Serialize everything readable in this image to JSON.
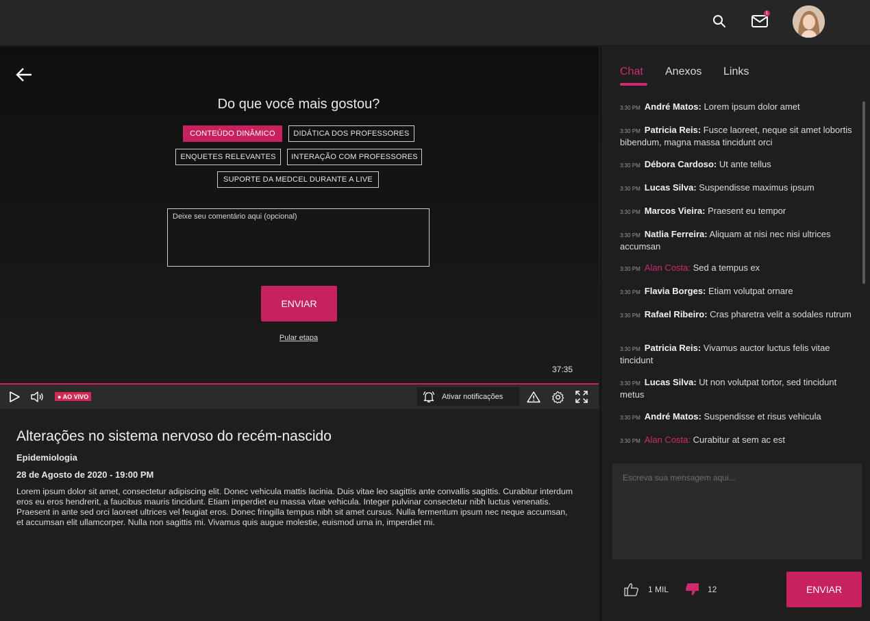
{
  "header": {
    "search_icon": "search-icon",
    "mail_icon": "mail-icon",
    "mail_badge": "1",
    "avatar": "user-avatar"
  },
  "survey": {
    "title": "Do que você mais gostou?",
    "options": [
      {
        "label": "CONTEÚDO DINÂMICO",
        "selected": true
      },
      {
        "label": "DIDÁTICA DOS PROFESSORES",
        "selected": false
      },
      {
        "label": "ENQUETES RELEVANTES",
        "selected": false
      },
      {
        "label": "INTERAÇÃO COM PROFESSORES",
        "selected": false
      },
      {
        "label": "SUPORTE DA MEDCEL DURANTE A LIVE",
        "selected": false
      }
    ],
    "comment_placeholder": "Deixe seu comentário aqui (opcional)",
    "submit_label": "ENVIAR",
    "skip_label": "Pular etapa"
  },
  "player": {
    "time": "37:35",
    "live_label": "● AO VIVO",
    "notify_label": "Ativar notificações"
  },
  "lesson": {
    "title": "Alterações no sistema nervoso do recém-nascido",
    "category": "Epidemiologia",
    "date": "28 de Agosto de 2020 - 19:00 PM",
    "description": "Lorem ipsum dolor sit amet, consectetur adipiscing elit. Donec vehicula mattis lacinia. Duis vitae leo sagittis ante convallis sagittis. Curabitur interdum eros eu eros hendrerit, a faucibus mauris tincidunt. Etiam imperdiet eu massa vitae vehicula. Integer pulvinar consectetur nibh luctus venenatis. Praesent in ante sed orci laoreet ultrices vel feugiat eros. Donec fringilla tempus nibh sit amet cursus. Nulla fermentum ipsum nec neque accumsan, et accumsan elit ullamcorper. Nulla non sagittis mi. Vivamus quis augue molestie, euismod urna in, imperdiet mi."
  },
  "sidebar": {
    "tabs": [
      "Chat",
      "Anexos",
      "Links"
    ],
    "messages": [
      {
        "time": "3:30 PM",
        "name": "André Matos:",
        "text": "Lorem ipsum dolor amet",
        "highlight": false
      },
      {
        "time": "3:30 PM",
        "name": "Patricia Reis:",
        "text": "Fusce laoreet, neque sit amet lobortis bibendum, magna massa tincidunt orci",
        "highlight": false
      },
      {
        "time": "3:30 PM",
        "name": "Débora Cardoso:",
        "text": "Ut ante tellus",
        "highlight": false
      },
      {
        "time": "3:30 PM",
        "name": "Lucas Silva:",
        "text": "Suspendisse maximus ipsum",
        "highlight": false
      },
      {
        "time": "3:30 PM",
        "name": "Marcos Vieira:",
        "text": "Praesent eu tempor",
        "highlight": false
      },
      {
        "time": "3:30 PM",
        "name": "Natlia Ferreira:",
        "text": "Aliquam at nisi nec nisi ultrices accumsan",
        "highlight": false
      },
      {
        "time": "3:30 PM",
        "name": "Alan Costa:",
        "text": "Sed a tempus ex",
        "highlight": true
      },
      {
        "time": "3:30 PM",
        "name": "Flavia Borges:",
        "text": "Etiam volutpat ornare",
        "highlight": false
      },
      {
        "time": "3:30 PM",
        "name": "Rafael Ribeiro:",
        "text": "Cras pharetra velit a sodales rutrum",
        "highlight": false
      },
      {
        "time": "3:30 PM",
        "name": "Patricia Reis:",
        "text": "Vivamus auctor luctus felis vitae tincidunt",
        "highlight": false
      },
      {
        "time": "3:30 PM",
        "name": "Lucas Silva:",
        "text": "Ut non volutpat tortor, sed tincidunt metus",
        "highlight": false
      },
      {
        "time": "3:30 PM",
        "name": "André Matos:",
        "text": "Suspendisse et risus vehicula",
        "highlight": false
      },
      {
        "time": "3:30 PM",
        "name": "Alan Costa:",
        "text": "Curabitur at sem ac est",
        "highlight": true
      }
    ],
    "input_placeholder": "Escreva sua mensagem aqui...",
    "likes": "1 MIL",
    "dislikes": "12",
    "send_label": "ENVIAR"
  },
  "colors": {
    "accent": "#c8215f",
    "background": "#1e1e1f",
    "header": "#262627"
  }
}
